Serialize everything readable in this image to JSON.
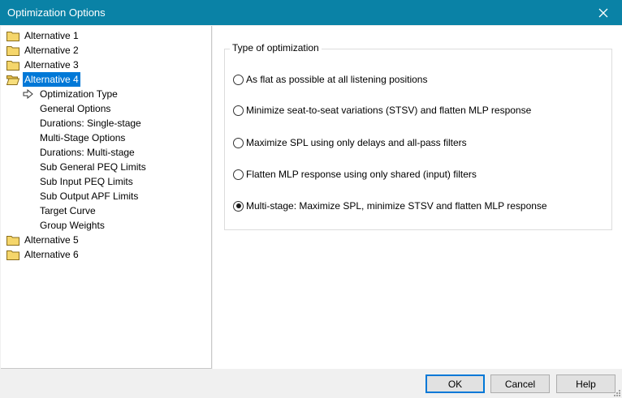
{
  "window": {
    "title": "Optimization Options"
  },
  "tree": {
    "alternatives": [
      {
        "label": "Alternative 1"
      },
      {
        "label": "Alternative 2"
      },
      {
        "label": "Alternative 3"
      },
      {
        "label": "Alternative 4"
      },
      {
        "label": "Alternative 5"
      },
      {
        "label": "Alternative 6"
      }
    ],
    "children": [
      {
        "label": "Optimization Type"
      },
      {
        "label": "General Options"
      },
      {
        "label": "Durations: Single-stage"
      },
      {
        "label": "Multi-Stage Options"
      },
      {
        "label": "Durations: Multi-stage"
      },
      {
        "label": "Sub General PEQ Limits"
      },
      {
        "label": "Sub Input PEQ Limits"
      },
      {
        "label": "Sub Output APF Limits"
      },
      {
        "label": "Target Curve"
      },
      {
        "label": "Group Weights"
      }
    ]
  },
  "group": {
    "legend": "Type of optimization",
    "options": [
      {
        "label": "As flat as possible at all listening positions"
      },
      {
        "label": "Minimize seat-to-seat variations (STSV) and flatten MLP response"
      },
      {
        "label": "Maximize SPL using only delays and all-pass filters"
      },
      {
        "label": "Flatten MLP response using only shared (input) filters"
      },
      {
        "label": "Multi-stage: Maximize SPL, minimize STSV and flatten MLP response"
      }
    ],
    "selected_index": 4
  },
  "buttons": {
    "ok": "OK",
    "cancel": "Cancel",
    "help": "Help"
  },
  "colors": {
    "titlebar": "#0a82a6",
    "selection": "#0078d7"
  }
}
